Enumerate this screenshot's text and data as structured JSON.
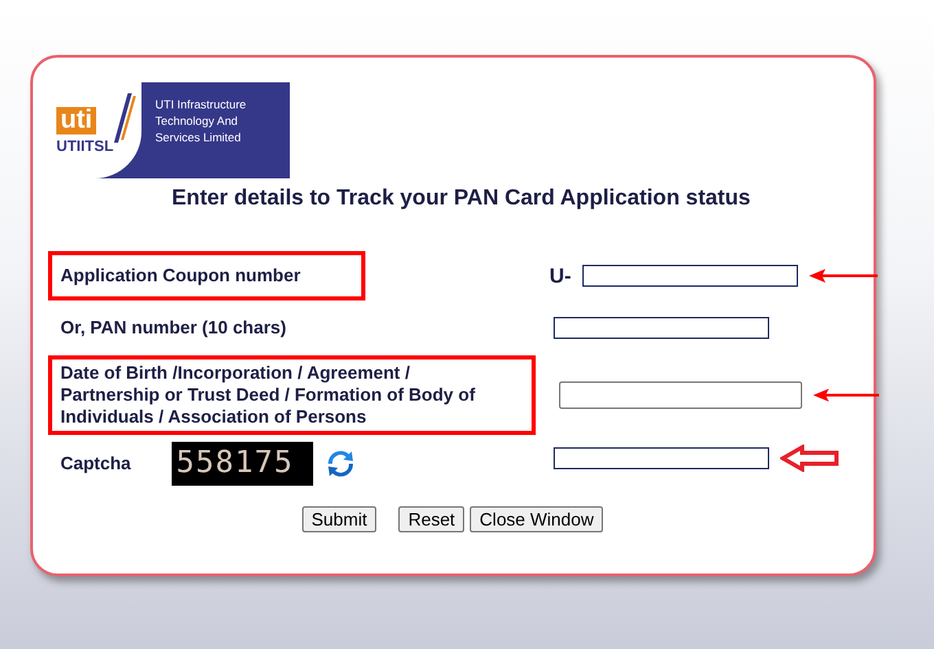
{
  "logo": {
    "mark": "uti",
    "name": "UTIITSL",
    "company_lines": [
      "UTI Infrastructure",
      "Technology And",
      "Services Limited"
    ]
  },
  "heading": "Enter details to Track your PAN Card Application status",
  "fields": [
    {
      "kind": "text",
      "label": "Application Coupon number",
      "prefix": "U-",
      "highlighted": true,
      "arrow": {
        "kind": "solid"
      }
    },
    {
      "kind": "text",
      "label": "Or, PAN number (10 chars)",
      "highlighted": false
    },
    {
      "kind": "date",
      "label": "Date of Birth /Incorporation / Agreement / Partnership or Trust Deed / Formation of Body of Individuals / Association of Persons",
      "highlighted": true,
      "arrow": {
        "kind": "solid"
      }
    },
    {
      "kind": "captcha",
      "label": "Captcha",
      "code": "558175",
      "highlighted": false,
      "arrow": {
        "kind": "outline"
      }
    }
  ],
  "buttons": [
    "Submit",
    "Reset",
    "Close Window"
  ]
}
